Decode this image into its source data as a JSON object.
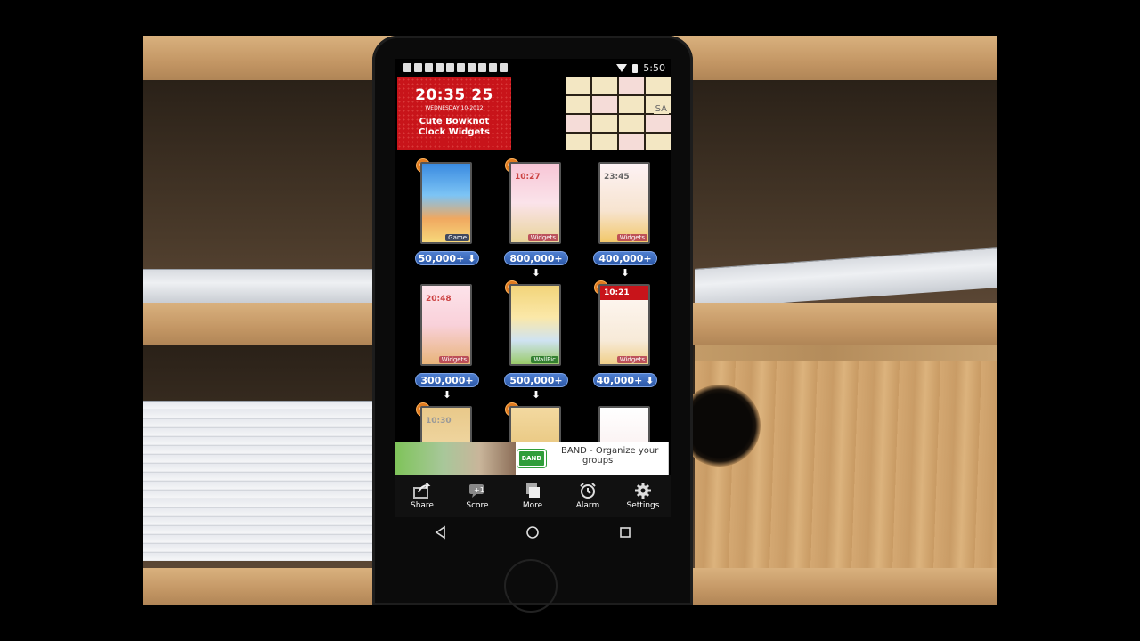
{
  "status_bar": {
    "time": "5:50"
  },
  "header_cards": {
    "clock": {
      "time": "20:35",
      "day": "25",
      "date": "WEDNESDAY 10-2012",
      "title_line1": "Cute Bowknot",
      "title_line2": "Clock Widgets"
    },
    "grid_preview": {
      "label": "SA"
    }
  },
  "apps": [
    {
      "tag": "Game",
      "count": "50,000+",
      "is_new": true,
      "time": ""
    },
    {
      "tag": "Widgets",
      "count": "800,000+",
      "is_new": true,
      "time": "10:27"
    },
    {
      "tag": "Widgets",
      "count": "400,000+",
      "is_new": false,
      "time": "23:45"
    },
    {
      "tag": "Widgets",
      "count": "300,000+",
      "is_new": false,
      "time": "20:48"
    },
    {
      "tag": "WallPic",
      "count": "500,000+",
      "is_new": true,
      "time": ""
    },
    {
      "tag": "Widgets",
      "count": "40,000+",
      "is_new": true,
      "time": "10:21"
    },
    {
      "tag": "",
      "count": "",
      "is_new": true,
      "time": "10:30"
    },
    {
      "tag": "",
      "count": "",
      "is_new": true,
      "time": ""
    },
    {
      "tag": "",
      "count": "",
      "is_new": false,
      "time": ""
    }
  ],
  "ad": {
    "logo": "BAND",
    "line1": "BAND - Organize your",
    "line2": "groups"
  },
  "toolbar": {
    "share": "Share",
    "score": "Score",
    "more": "More",
    "alarm": "Alarm",
    "settings": "Settings"
  },
  "colors": {
    "accent": "#2c58a8",
    "clock_card": "#c8141a",
    "ad_brand": "#2f9e3a"
  }
}
